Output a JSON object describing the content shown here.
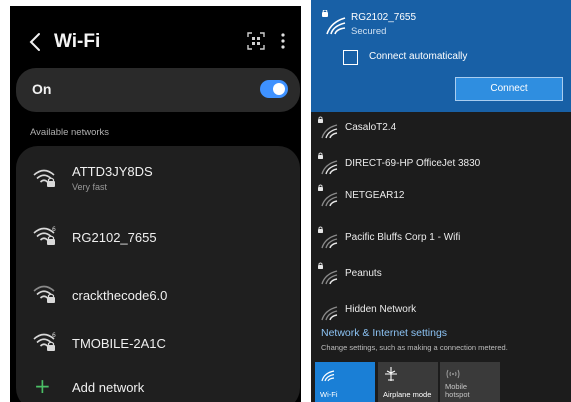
{
  "phone": {
    "title": "Wi-Fi",
    "back_icon": "chevron-left-icon",
    "toggle_label": "On",
    "toggle_on": true,
    "available_label": "Available networks",
    "networks": [
      {
        "name": "ATTD3JY8DS",
        "subtitle": "Very fast",
        "icon": "wifi-lock-icon"
      },
      {
        "name": "RG2102_7655",
        "subtitle": "",
        "icon": "wifi-6-lock-icon"
      },
      {
        "name": "crackthecode6.0",
        "subtitle": "",
        "icon": "wifi-lock-icon"
      },
      {
        "name": "TMOBILE-2A1C",
        "subtitle": "",
        "icon": "wifi-6-lock-icon"
      }
    ],
    "add_network": "Add network",
    "accent": "#3e91ff",
    "add_color": "#4bbf66"
  },
  "windows": {
    "selected": {
      "name": "RG2102_7655",
      "status": "Secured",
      "auto_connect_label": "Connect automatically",
      "connect_label": "Connect"
    },
    "networks": [
      {
        "name": "CasaloT2.4"
      },
      {
        "name": "DIRECT-69-HP OfficeJet 3830"
      },
      {
        "name": "NETGEAR12"
      },
      {
        "name": "Pacific Bluffs Corp 1 - Wifi"
      },
      {
        "name": "Peanuts"
      },
      {
        "name": "Hidden Network"
      }
    ],
    "settings_link": "Network & Internet settings",
    "settings_desc": "Change settings, such as making a connection metered.",
    "tiles": [
      {
        "label": "Wi-Fi",
        "sub": "",
        "active": true
      },
      {
        "label": "Airplane mode",
        "sub": "",
        "active": false
      },
      {
        "label": "hotspot",
        "sub": "Mobile",
        "active": false
      }
    ],
    "accent": "#1860a6"
  }
}
